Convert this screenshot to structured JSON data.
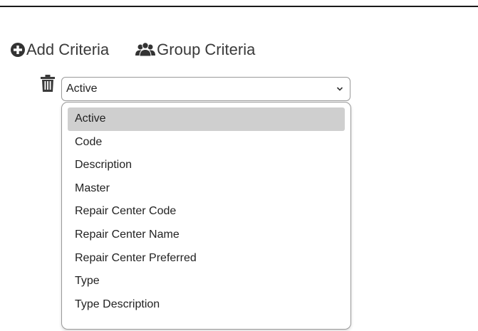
{
  "toolbar": {
    "add_label": "Add Criteria",
    "add_icon": "plus-circle-icon",
    "group_label": "Group Criteria",
    "group_icon": "users-icon"
  },
  "criteria": {
    "delete_icon": "trash-icon",
    "selected_value": "Active"
  },
  "dropdown": {
    "options": [
      "Active",
      "Code",
      "Description",
      "Master",
      "Repair Center Code",
      "Repair Center Name",
      "Repair Center Preferred",
      "Type",
      "Type Description"
    ],
    "highlighted_option": "Active"
  },
  "colors": {
    "highlight": "#cfcfcf",
    "border": "#9a9a9a",
    "text": "#222222"
  }
}
